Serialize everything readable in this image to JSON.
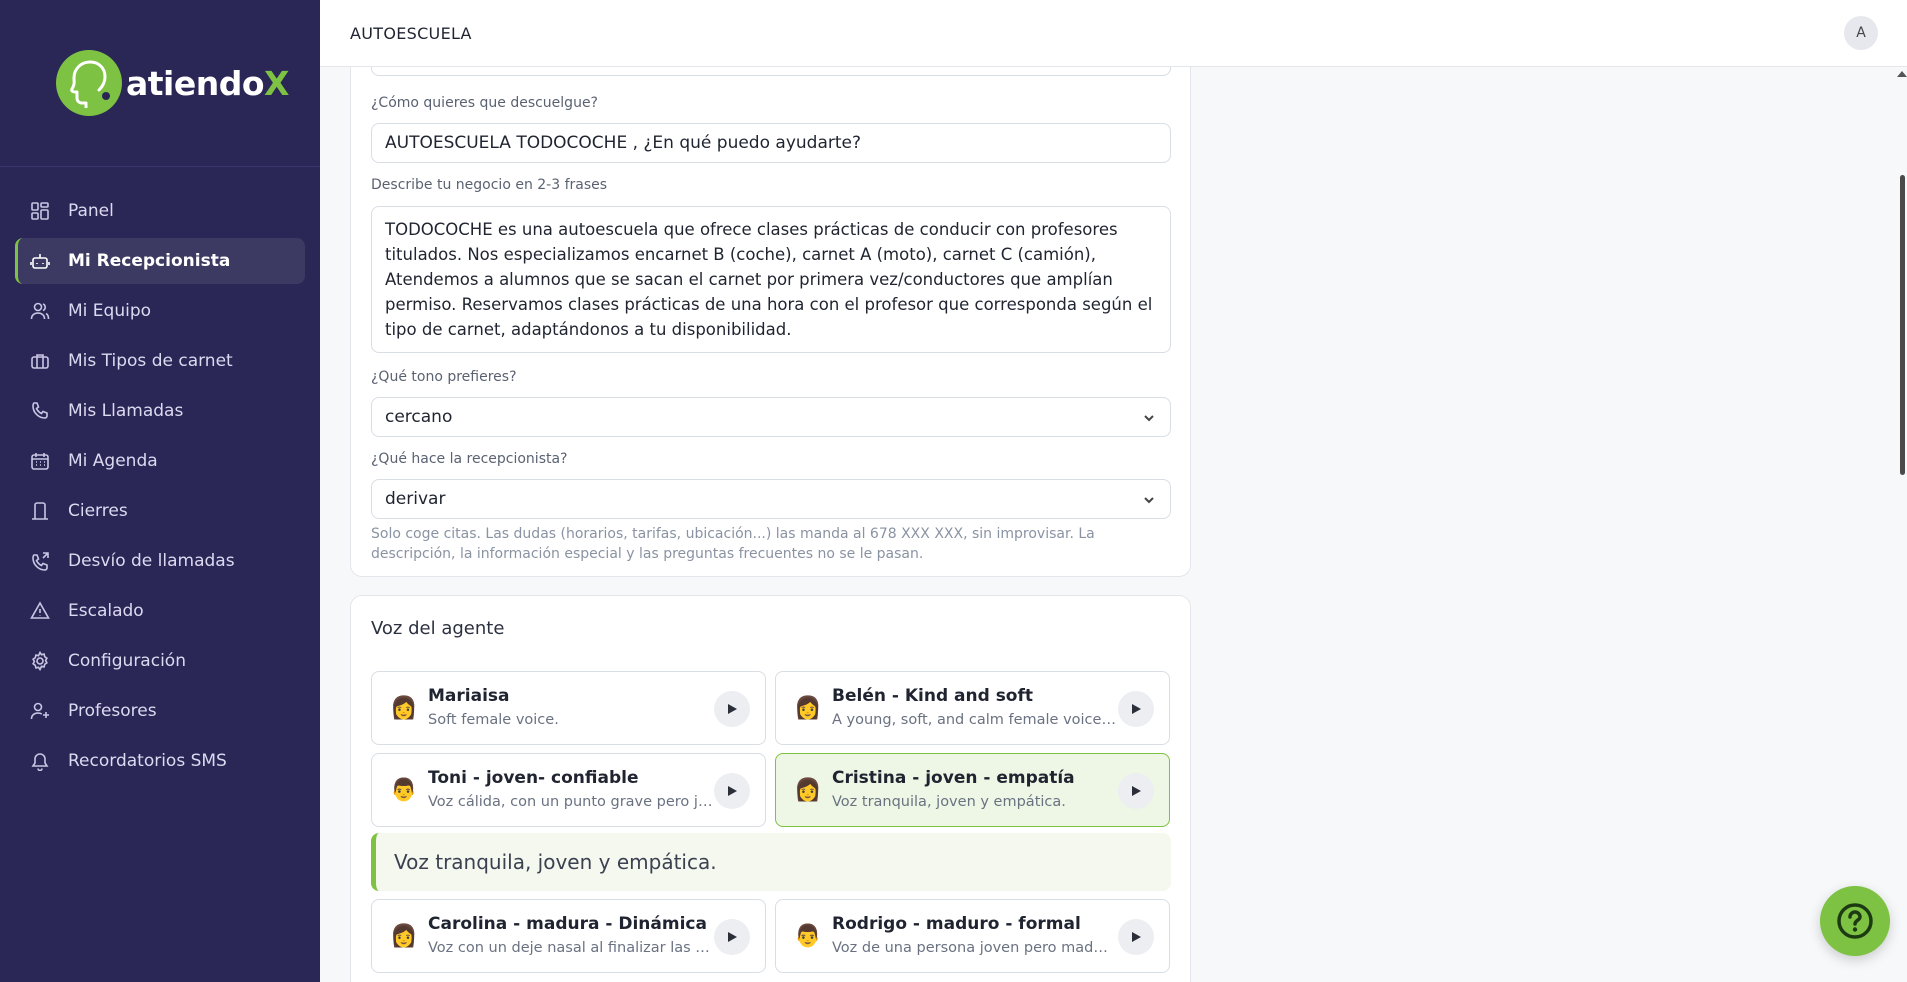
{
  "app": {
    "logo_main": "atiendo",
    "logo_accent": "X",
    "brand_color": "#7dc242",
    "sidebar_color": "#2a2656"
  },
  "sidebar": {
    "items": [
      {
        "label": "Panel",
        "icon": "grid-icon",
        "active": false
      },
      {
        "label": "Mi Recepcionista",
        "icon": "bot-icon",
        "active": true
      },
      {
        "label": "Mi Equipo",
        "icon": "users-icon",
        "active": false
      },
      {
        "label": "Mis Tipos de carnet",
        "icon": "briefcase-icon",
        "active": false
      },
      {
        "label": "Mis Llamadas",
        "icon": "phone-icon",
        "active": false
      },
      {
        "label": "Mi Agenda",
        "icon": "calendar-icon",
        "active": false
      },
      {
        "label": "Cierres",
        "icon": "closed-icon",
        "active": false
      },
      {
        "label": "Desvío de llamadas",
        "icon": "phone-forward-icon",
        "active": false
      },
      {
        "label": "Escalado",
        "icon": "alert-triangle-icon",
        "active": false
      },
      {
        "label": "Configuración",
        "icon": "gear-icon",
        "active": false
      },
      {
        "label": "Profesores",
        "icon": "user-plus-icon",
        "active": false
      },
      {
        "label": "Recordatorios SMS",
        "icon": "bell-icon",
        "active": false
      }
    ]
  },
  "topbar": {
    "title": "AUTOESCUELA",
    "avatar_initial": "A"
  },
  "form": {
    "greeting_label": "¿Cómo quieres que descuelgue?",
    "greeting_value": "AUTOESCUELA TODOCOCHE , ¿En qué puedo ayudarte?",
    "business_label": "Describe tu negocio en 2-3 frases",
    "business_value": "TODOCOCHE es una autoescuela que ofrece clases prácticas de conducir con profesores titulados. Nos especializamos encarnet B (coche), carnet A (moto), carnet C (camión), Atendemos a alumnos que se sacan el carnet por primera vez/conductores que amplían permiso. Reservamos clases prácticas de una hora con el profesor que corresponda según el tipo de carnet, adaptándonos a tu disponibilidad.",
    "tone_label": "¿Qué tono prefieres?",
    "tone_value": "cercano",
    "role_label": "¿Qué hace la recepcionista?",
    "role_value": "derivar",
    "role_helper": "Solo coge citas. Las dudas (horarios, tarifas, ubicación...) las manda al 678 XXX XXX, sin improvisar. La descripción, la información especial y las preguntas frecuentes no se le pasan."
  },
  "voices": {
    "section_title": "Voz del agente",
    "selected_preview": "Voz tranquila, joven y empática.",
    "items": [
      {
        "name": "Mariaisa",
        "desc": "Soft female voice.",
        "emoji": "👩",
        "selected": false
      },
      {
        "name": "Belén - Kind and soft",
        "desc": "A young, soft, and calm female voice w...",
        "emoji": "👩",
        "selected": false
      },
      {
        "name": "Toni - joven- confiable",
        "desc": "Voz cálida, con un punto grave pero ju...",
        "emoji": "👨",
        "selected": false
      },
      {
        "name": "Cristina - joven - empatía",
        "desc": "Voz tranquila, joven y empática.",
        "emoji": "👩",
        "selected": true
      },
      {
        "name": "Carolina - madura - Dinámica",
        "desc": "Voz con un deje nasal al finalizar las pa...",
        "emoji": "👩",
        "selected": false
      },
      {
        "name": "Rodrigo - maduro - formal",
        "desc": "Voz de una persona joven pero madur...",
        "emoji": "👨",
        "selected": false
      }
    ]
  }
}
